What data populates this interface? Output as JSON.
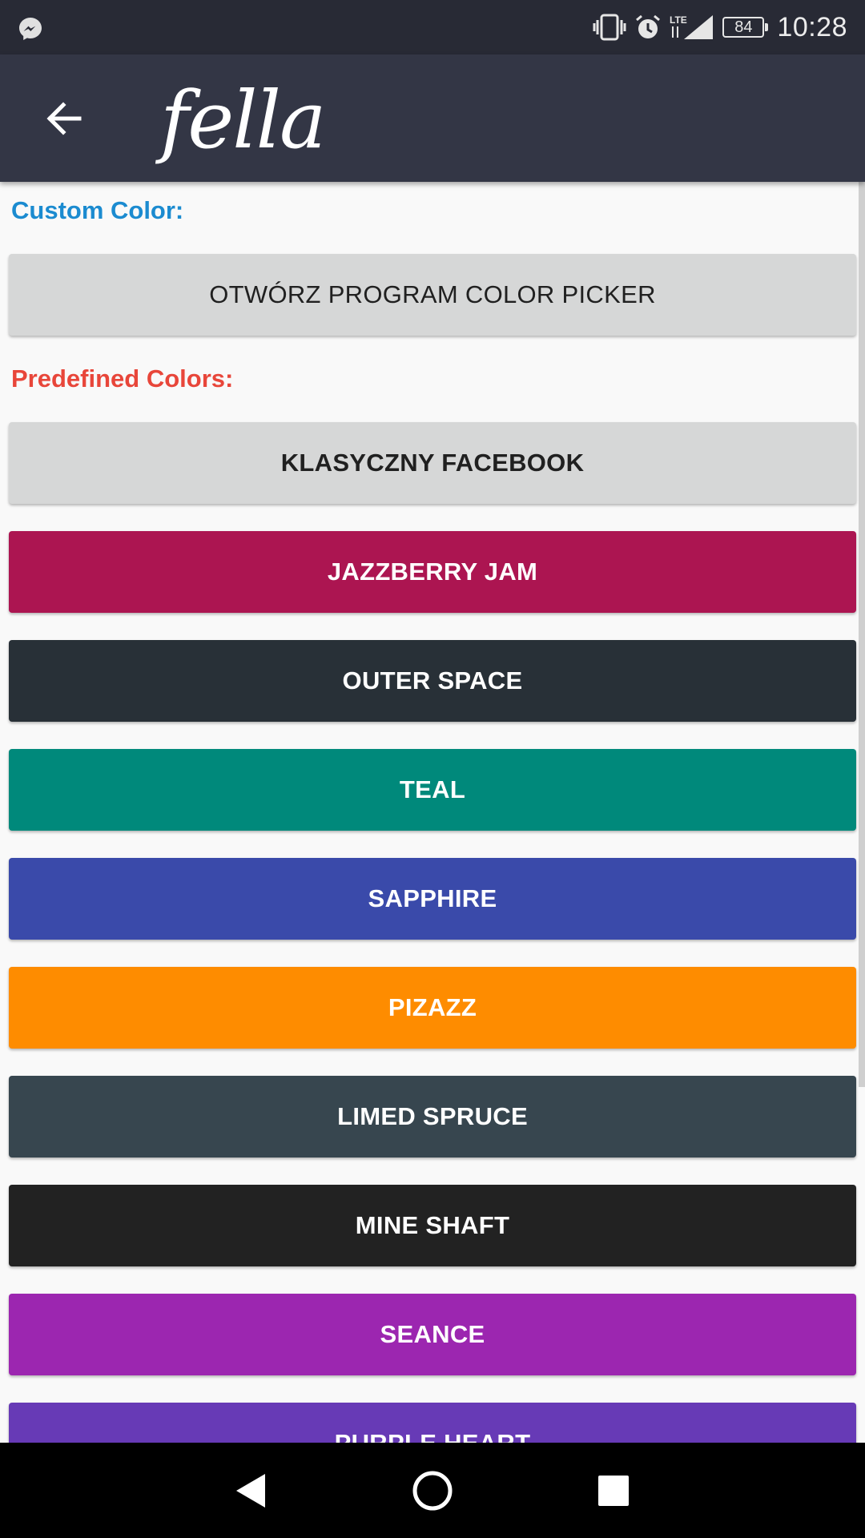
{
  "status_bar": {
    "notification_icon": "messenger-icon",
    "icons": [
      "vibrate-icon",
      "alarm-icon",
      "lte-icon",
      "signal-icon"
    ],
    "battery_level": "84",
    "time": "10:28"
  },
  "app_bar": {
    "back_icon": "arrow-left-icon",
    "title": "fella",
    "background": "#333645"
  },
  "custom_section": {
    "label": "Custom Color:",
    "label_color": "#1b8bd0",
    "button_label": "OTWÓRZ PROGRAM COLOR PICKER"
  },
  "predefined_section": {
    "label": "Predefined Colors:",
    "label_color": "#e8463a",
    "colors": [
      {
        "label": "KLASYCZNY FACEBOOK",
        "bg": "#d6d7d7",
        "fg": "#202020"
      },
      {
        "label": "JAZZBERRY JAM",
        "bg": "#ac1551",
        "fg": "#ffffff"
      },
      {
        "label": "OUTER SPACE",
        "bg": "#283037",
        "fg": "#ffffff"
      },
      {
        "label": "TEAL",
        "bg": "#00897b",
        "fg": "#ffffff"
      },
      {
        "label": "SAPPHIRE",
        "bg": "#3a4aaa",
        "fg": "#ffffff"
      },
      {
        "label": "PIZAZZ",
        "bg": "#fe8c00",
        "fg": "#ffffff"
      },
      {
        "label": "LIMED SPRUCE",
        "bg": "#37464f",
        "fg": "#ffffff"
      },
      {
        "label": "MINE SHAFT",
        "bg": "#222222",
        "fg": "#ffffff"
      },
      {
        "label": "SEANCE",
        "bg": "#9c26b0",
        "fg": "#ffffff"
      },
      {
        "label": "PURPLE HEART",
        "bg": "#673ab6",
        "fg": "#ffffff"
      }
    ]
  },
  "nav_bar": {
    "buttons": [
      "back-triangle-icon",
      "home-circle-icon",
      "recents-square-icon"
    ]
  }
}
